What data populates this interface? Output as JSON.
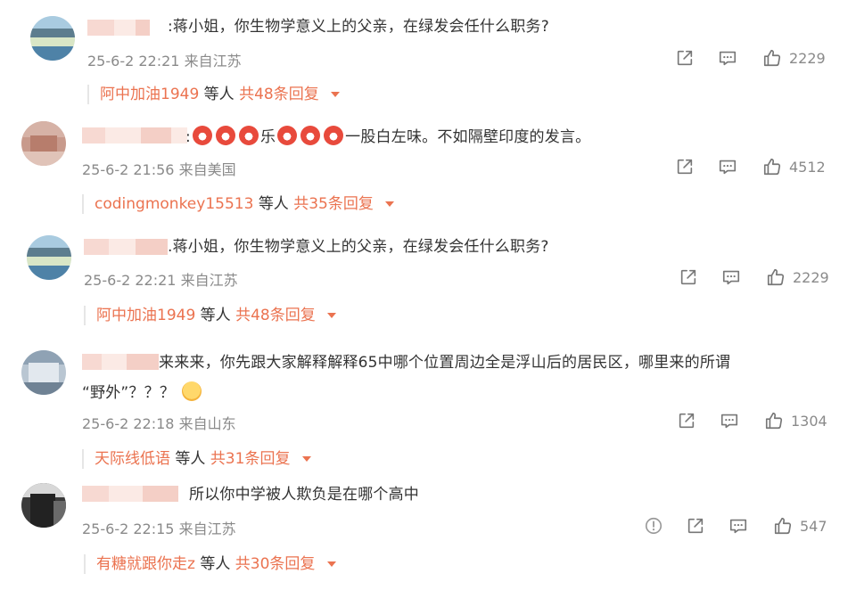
{
  "comments": [
    {
      "text": ":蒋小姐，你生物学意义上的父亲，在绿发会任什么职务?",
      "time": "25-6-2 22:21",
      "location": "来自江苏",
      "likes": "2229",
      "reply_user": "阿中加油1949",
      "reply_and": "等人",
      "reply_count": "共48条回复"
    },
    {
      "text_emoji_a": ":",
      "text_mid": "乐",
      "text_tail": "一股白左味。不如隔壁印度的发言。",
      "time": "25-6-2 21:56",
      "location": "来自美国",
      "likes": "4512",
      "reply_user": "codingmonkey15513",
      "reply_and": "等人",
      "reply_count": "共35条回复"
    },
    {
      "text": ".蒋小姐，你生物学意义上的父亲，在绿发会任什么职务?",
      "time": "25-6-2 22:21",
      "location": "来自江苏",
      "likes": "2229",
      "reply_user": "阿中加油1949",
      "reply_and": "等人",
      "reply_count": "共48条回复"
    },
    {
      "text_line1": "来来来，你先跟大家解释解释65中哪个位置周边全是浮山后的居民区，哪里来的所谓",
      "text_line2": "“野外”？？？",
      "time": "25-6-2 22:18",
      "location": "来自山东",
      "likes": "1304",
      "reply_user": "天际线低语",
      "reply_and": "等人",
      "reply_count": "共31条回复"
    },
    {
      "text": "所以你中学被人欺负是在哪个高中",
      "time": "25-6-2 22:15",
      "location": "来自江苏",
      "likes": "547",
      "reply_user": "有糖就跟你走z",
      "reply_and": "等人",
      "reply_count": "共30条回复"
    }
  ],
  "colors": {
    "accent": "#eb7350",
    "meta": "#8a8a8a",
    "text": "#333333"
  },
  "icons": [
    "share-icon",
    "comment-icon",
    "like-icon",
    "report-icon",
    "dropdown-caret-icon"
  ]
}
